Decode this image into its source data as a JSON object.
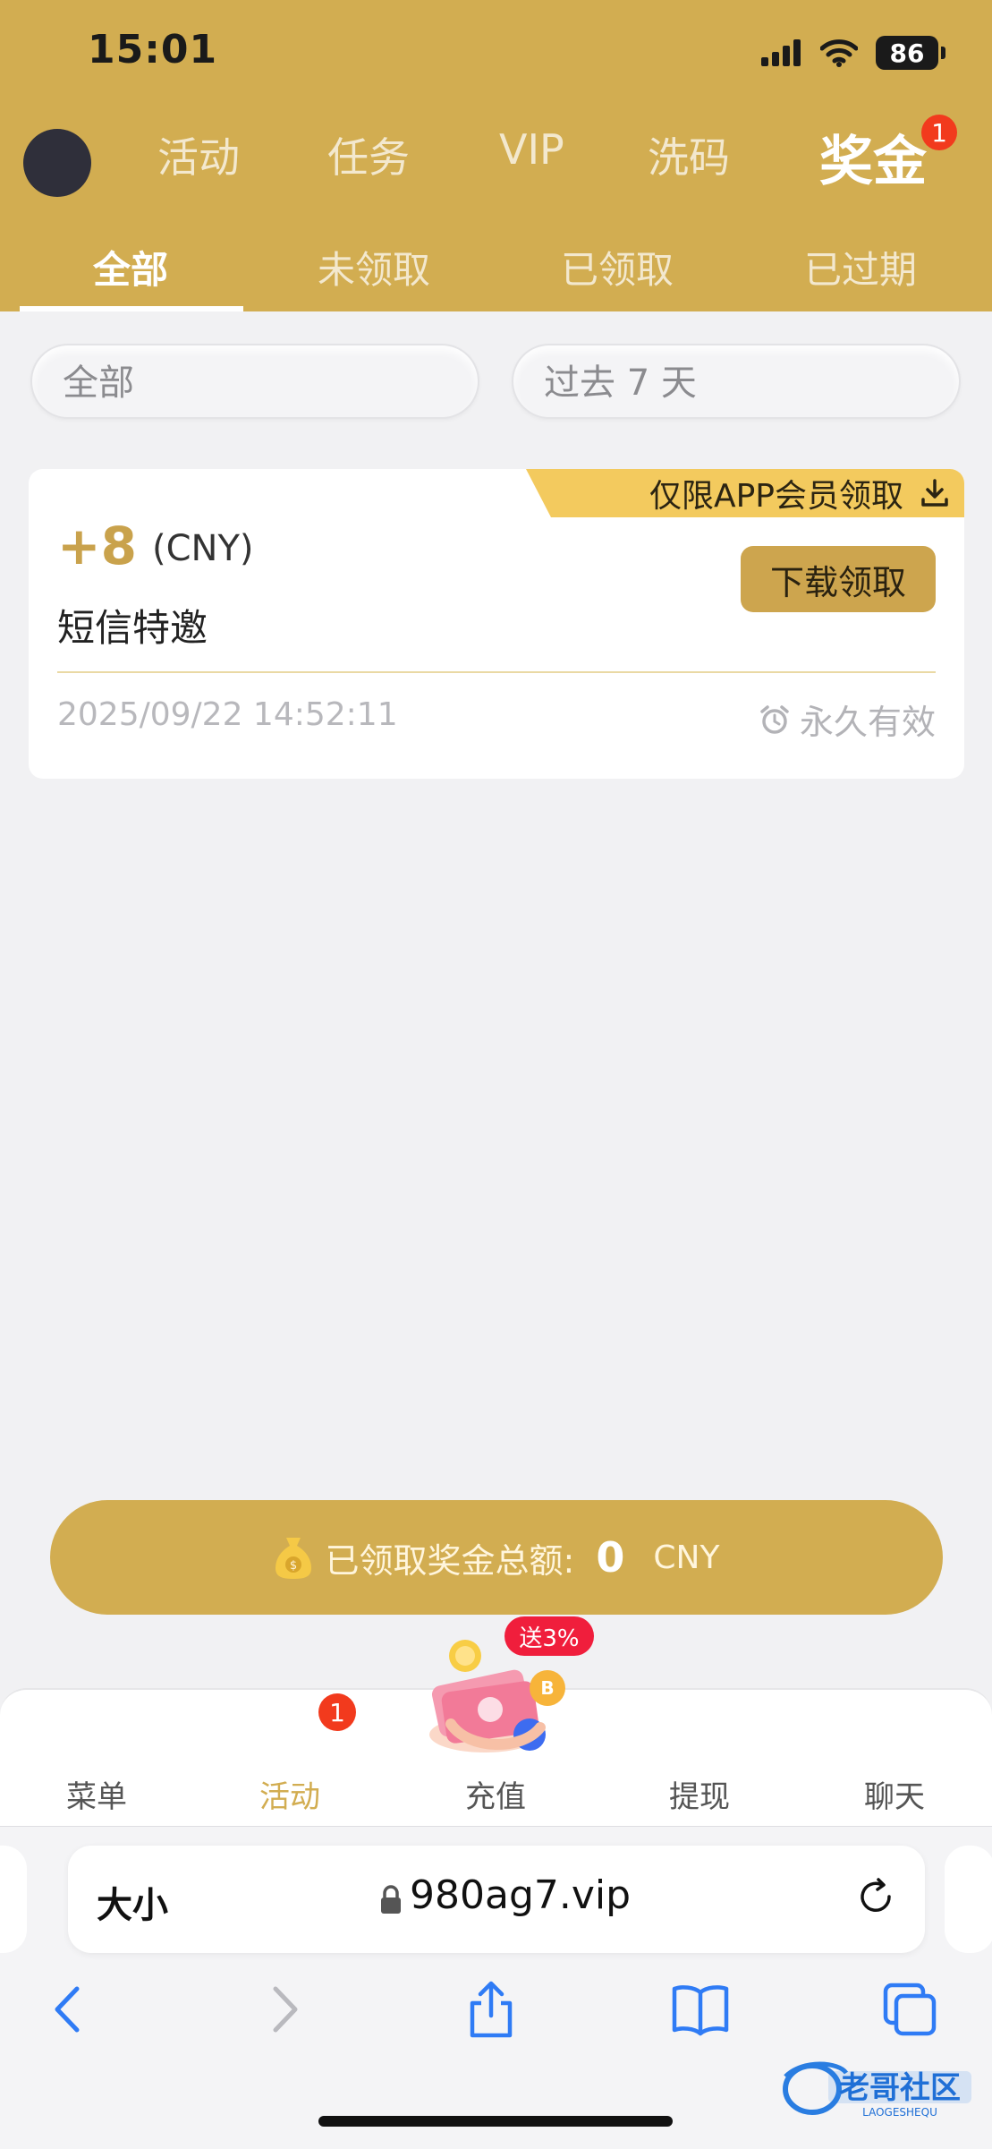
{
  "status_bar": {
    "time": "15:01",
    "battery": "86"
  },
  "top_nav": {
    "tabs": [
      {
        "label": "活动"
      },
      {
        "label": "任务"
      },
      {
        "label": "VIP"
      },
      {
        "label": "洗码"
      },
      {
        "label": "奖金",
        "active": true
      }
    ],
    "badge": "1"
  },
  "sub_tabs": [
    {
      "label": "全部",
      "active": true
    },
    {
      "label": "未领取"
    },
    {
      "label": "已领取"
    },
    {
      "label": "已过期"
    }
  ],
  "filters": {
    "type": "全部",
    "period": "过去 7 天"
  },
  "bonus_card": {
    "ribbon": "仅限APP会员领取",
    "amount": "+8",
    "currency": "(CNY)",
    "name": "短信特邀",
    "claim_button": "下载领取",
    "date": "2025/09/22 14:52:11",
    "validity": "永久有效"
  },
  "total": {
    "label": "已领取奖金总额:",
    "value": "0",
    "currency": "CNY"
  },
  "bottom_nav": {
    "items": [
      {
        "label": "菜单"
      },
      {
        "label": "活动",
        "active": true
      },
      {
        "label": "充值"
      },
      {
        "label": "提现"
      },
      {
        "label": "聊天"
      }
    ],
    "badge": "1",
    "promo": "送3%"
  },
  "browser": {
    "text_size": "大小",
    "url": "980ag7.vip"
  },
  "watermark": {
    "text": "老哥社区",
    "sub": "LAOGESHEQU"
  },
  "colors": {
    "brand_gold": "#d2ad51",
    "badge_red": "#f23a1d",
    "ribbon_yellow": "#f3ca5e"
  }
}
